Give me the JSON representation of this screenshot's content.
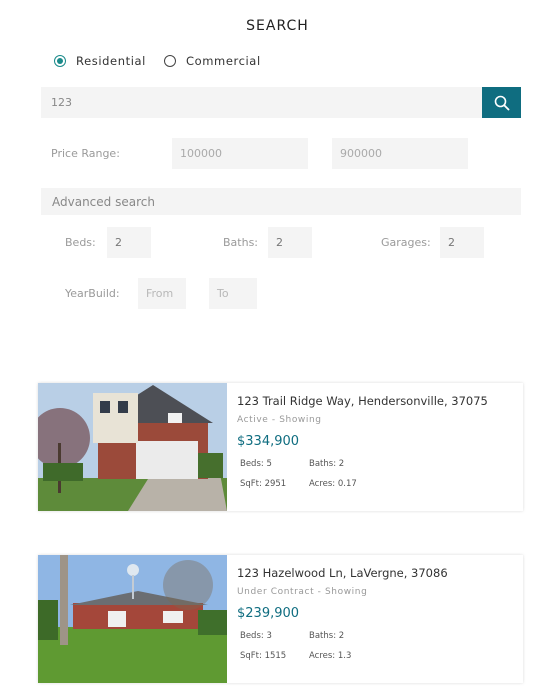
{
  "header": {
    "title": "SEARCH"
  },
  "property_type": {
    "options": [
      {
        "label": "Residential",
        "selected": true
      },
      {
        "label": "Commercial",
        "selected": false
      }
    ]
  },
  "search": {
    "value": "123",
    "button_icon": "search-icon"
  },
  "price_range": {
    "label": "Price Range:",
    "min": "100000",
    "max": "900000"
  },
  "advanced": {
    "label": "Advanced search",
    "beds_label": "Beds:",
    "beds_value": "2",
    "baths_label": "Baths:",
    "baths_value": "2",
    "garages_label": "Garages:",
    "garages_value": "2",
    "yearbuild_label": "YearBuild:",
    "from_placeholder": "From",
    "to_placeholder": "To"
  },
  "listings": [
    {
      "address": "123 Trail Ridge Way, Hendersonville, 37075",
      "status": "Active - Showing",
      "price": "$334,900",
      "beds": "Beds: 5",
      "baths": "Baths: 2",
      "sqft": "SqFt: 2951",
      "acres": "Acres: 0.17"
    },
    {
      "address": "123 Hazelwood Ln, LaVergne, 37086",
      "status": "Under Contract - Showing",
      "price": "$239,900",
      "beds": "Beds: 3",
      "baths": "Baths: 2",
      "sqft": "SqFt: 1515",
      "acres": "Acres: 1.3"
    }
  ],
  "colors": {
    "accent": "#0f6d80",
    "radio": "#1a8a8a",
    "field_bg": "#f4f4f4"
  }
}
